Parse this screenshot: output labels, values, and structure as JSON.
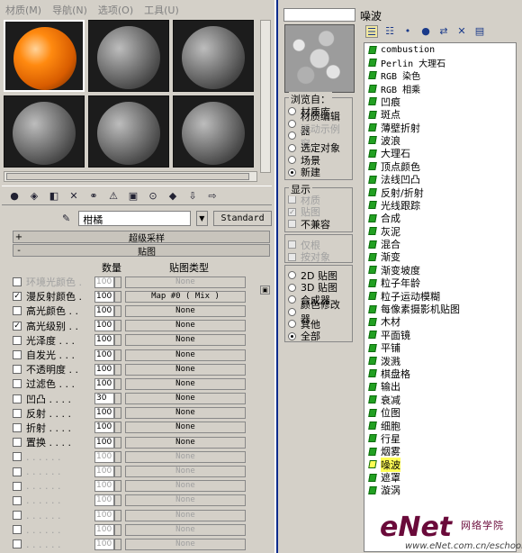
{
  "menubar": {
    "items": [
      "材质(M)",
      "导航(N)",
      "选项(O)",
      "工具(U)"
    ]
  },
  "toolbar": {
    "icons": [
      "get-material-icon",
      "put-to-scene-icon",
      "assign-material-icon",
      "delete-icon",
      "make-unique-icon",
      "put-to-library-icon",
      "material-effects-icon",
      "show-map-icon",
      "show-end-result-icon",
      "go-to-parent-icon",
      "go-forward-icon"
    ]
  },
  "material": {
    "name": "柑橘",
    "type_button": "Standard"
  },
  "rollouts": {
    "supersampling": "超级采样",
    "maps": "贴图"
  },
  "maps_header": {
    "amount": "数量",
    "map_type": "贴图类型"
  },
  "map_rows": [
    {
      "label": "环境光颜色 .",
      "checked": false,
      "amount": "100",
      "map": "None",
      "dim": true
    },
    {
      "label": "漫反射颜色 .",
      "checked": true,
      "amount": "100",
      "map": "Map #0  ( Mix )",
      "dim": false
    },
    {
      "label": "高光颜色 . .",
      "checked": false,
      "amount": "100",
      "map": "None",
      "dim": false
    },
    {
      "label": "高光级别 . .",
      "checked": true,
      "amount": "100",
      "map": "None",
      "dim": false
    },
    {
      "label": "光泽度 . . .",
      "checked": false,
      "amount": "100",
      "map": "None",
      "dim": false
    },
    {
      "label": "自发光 . . .",
      "checked": false,
      "amount": "100",
      "map": "None",
      "dim": false
    },
    {
      "label": "不透明度 . .",
      "checked": false,
      "amount": "100",
      "map": "None",
      "dim": false
    },
    {
      "label": "过滤色 . . .",
      "checked": false,
      "amount": "100",
      "map": "None",
      "dim": false
    },
    {
      "label": "凹凸 . . . .",
      "checked": false,
      "amount": "30",
      "map": "None",
      "dim": false
    },
    {
      "label": "反射 . . . .",
      "checked": false,
      "amount": "100",
      "map": "None",
      "dim": false
    },
    {
      "label": "折射 . . . .",
      "checked": false,
      "amount": "100",
      "map": "None",
      "dim": false
    },
    {
      "label": "置换 . . . .",
      "checked": false,
      "amount": "100",
      "map": "None",
      "dim": false
    },
    {
      "label": ". . . . . .",
      "checked": false,
      "amount": "100",
      "map": "None",
      "dim": true
    },
    {
      "label": ". . . . . .",
      "checked": false,
      "amount": "100",
      "map": "None",
      "dim": true
    },
    {
      "label": ". . . . . .",
      "checked": false,
      "amount": "100",
      "map": "None",
      "dim": true
    },
    {
      "label": ". . . . . .",
      "checked": false,
      "amount": "100",
      "map": "None",
      "dim": true
    },
    {
      "label": ". . . . . .",
      "checked": false,
      "amount": "100",
      "map": "None",
      "dim": true
    },
    {
      "label": ". . . . . .",
      "checked": false,
      "amount": "100",
      "map": "None",
      "dim": true
    },
    {
      "label": ". . . . . .",
      "checked": false,
      "amount": "100",
      "map": "None",
      "dim": true
    }
  ],
  "browser": {
    "title": "噪波",
    "browse_from_title": "浏览自：",
    "browse_from": [
      {
        "label": "材质库",
        "on": false,
        "disabled": false
      },
      {
        "label": "材质编辑器",
        "on": false,
        "disabled": false
      },
      {
        "label": "活动示例窗",
        "on": false,
        "disabled": true
      },
      {
        "label": "选定对象",
        "on": false,
        "disabled": false
      },
      {
        "label": "场景",
        "on": false,
        "disabled": false
      },
      {
        "label": "新建",
        "on": true,
        "disabled": false
      }
    ],
    "show_title": "显示",
    "show": [
      {
        "label": "材质",
        "checked": false,
        "disabled": true
      },
      {
        "label": "贴图",
        "checked": true,
        "disabled": true
      },
      {
        "label": "不兼容",
        "checked": false,
        "disabled": false
      }
    ],
    "show2": [
      {
        "label": "仅根",
        "checked": false,
        "disabled": true
      },
      {
        "label": "按对象",
        "checked": false,
        "disabled": true
      }
    ],
    "filter": [
      {
        "label": "2D 贴图",
        "on": false
      },
      {
        "label": "3D 贴图",
        "on": false
      },
      {
        "label": "合成器",
        "on": false
      },
      {
        "label": "颜色修改器",
        "on": false
      },
      {
        "label": "其他",
        "on": false
      },
      {
        "label": "全部",
        "on": true
      }
    ],
    "items": [
      "combustion",
      "Perlin 大理石",
      "RGB 染色",
      "RGB 相乘",
      "凹痕",
      "斑点",
      "薄壁折射",
      "波浪",
      "大理石",
      "顶点颜色",
      "法线凹凸",
      "反射/折射",
      "光线跟踪",
      "合成",
      "灰泥",
      "混合",
      "渐变",
      "渐变坡度",
      "粒子年龄",
      "粒子运动模糊",
      "每像素摄影机贴图",
      "木材",
      "平面镜",
      "平铺",
      "泼溅",
      "棋盘格",
      "输出",
      "衰减",
      "位图",
      "细胞",
      "行星",
      "烟雾",
      "噪波",
      "遮罩",
      "漩涡"
    ],
    "selected": "噪波"
  },
  "watermark": {
    "brand": "eNet",
    "sub": "网络学院",
    "url": "www.eNet.com.cn/eschool"
  }
}
